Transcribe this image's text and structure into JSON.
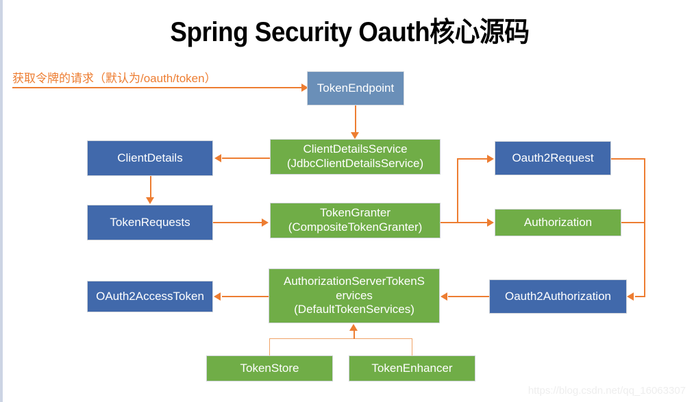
{
  "title": "Spring Security Oauth核心源码",
  "request_label": "获取令牌的请求（默认为/oauth/token）",
  "watermark": "https://blog.csdn.net/qq_16063307",
  "colors": {
    "blue": "#4169ab",
    "blue_light": "#6a8fb8",
    "green": "#70ad47",
    "arrow": "#ed7d31",
    "background": "#ffffff",
    "title": "#000000"
  },
  "nodes": [
    {
      "id": "token-endpoint",
      "label": "TokenEndpoint",
      "lines": [
        "TokenEndpoint"
      ],
      "color": "blue_light"
    },
    {
      "id": "client-details",
      "label": "ClientDetails",
      "lines": [
        "ClientDetails"
      ],
      "color": "blue"
    },
    {
      "id": "client-details-service",
      "label": "ClientDetailsService (JdbcClientDetailsService)",
      "lines": [
        "ClientDetailsService",
        "(JdbcClientDetailsService)"
      ],
      "color": "green"
    },
    {
      "id": "oauth2-request",
      "label": "Oauth2Request",
      "lines": [
        "Oauth2Request"
      ],
      "color": "blue"
    },
    {
      "id": "token-requests",
      "label": "TokenRequests",
      "lines": [
        "TokenRequests"
      ],
      "color": "blue"
    },
    {
      "id": "token-granter",
      "label": "TokenGranter (CompositeTokenGranter)",
      "lines": [
        "TokenGranter",
        "(CompositeTokenGranter)"
      ],
      "color": "green"
    },
    {
      "id": "authorization",
      "label": "Authorization",
      "lines": [
        "Authorization"
      ],
      "color": "green"
    },
    {
      "id": "oauth2-access-token",
      "label": "OAuth2AccessToken",
      "lines": [
        "OAuth2AccessToken"
      ],
      "color": "blue"
    },
    {
      "id": "authorization-server-token-services",
      "label": "AuthorizationServerTokenServices (DefaultTokenServices)",
      "lines": [
        "AuthorizationServerTokenS",
        "ervices",
        "(DefaultTokenServices)"
      ],
      "color": "green"
    },
    {
      "id": "oauth2-authorization",
      "label": "Oauth2Authorization",
      "lines": [
        "Oauth2Authorization"
      ],
      "color": "blue"
    },
    {
      "id": "token-store",
      "label": "TokenStore",
      "lines": [
        "TokenStore"
      ],
      "color": "green"
    },
    {
      "id": "token-enhancer",
      "label": "TokenEnhancer",
      "lines": [
        "TokenEnhancer"
      ],
      "color": "green"
    }
  ],
  "edges": [
    {
      "id": "request-to-token-endpoint",
      "from": "external-request",
      "to": "token-endpoint"
    },
    {
      "id": "token-endpoint-to-client-details-service",
      "from": "token-endpoint",
      "to": "client-details-service"
    },
    {
      "id": "client-details-service-to-client-details",
      "from": "client-details-service",
      "to": "client-details"
    },
    {
      "id": "client-details-to-token-requests",
      "from": "client-details",
      "to": "token-requests"
    },
    {
      "id": "token-requests-to-token-granter",
      "from": "token-requests",
      "to": "token-granter"
    },
    {
      "id": "token-granter-to-oauth2-request",
      "from": "token-granter",
      "to": "oauth2-request"
    },
    {
      "id": "token-granter-to-authorization",
      "from": "token-granter",
      "to": "authorization"
    },
    {
      "id": "oauth2-request-to-oauth2-authorization",
      "from": "oauth2-request",
      "to": "oauth2-authorization"
    },
    {
      "id": "authorization-to-oauth2-authorization",
      "from": "authorization",
      "to": "oauth2-authorization"
    },
    {
      "id": "oauth2-authorization-to-token-services",
      "from": "oauth2-authorization",
      "to": "authorization-server-token-services"
    },
    {
      "id": "token-services-to-access-token",
      "from": "authorization-server-token-services",
      "to": "oauth2-access-token"
    },
    {
      "id": "token-store-to-token-services",
      "from": "token-store",
      "to": "authorization-server-token-services"
    },
    {
      "id": "token-enhancer-to-token-services",
      "from": "token-enhancer",
      "to": "authorization-server-token-services"
    }
  ]
}
